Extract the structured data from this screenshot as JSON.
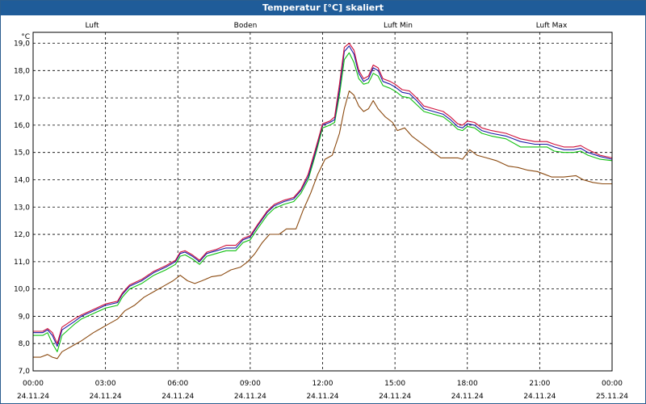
{
  "window": {
    "title": "Temperatur [°C] skaliert"
  },
  "chart_data": {
    "type": "line",
    "title": "Temperatur [°C] skaliert",
    "ylabel": "°C",
    "xlabel": "",
    "ylim": [
      7.0,
      19.4
    ],
    "xlim": [
      0,
      24
    ],
    "yticks": [
      "7,0",
      "8,0",
      "9,0",
      "10,0",
      "11,0",
      "12,0",
      "13,0",
      "14,0",
      "15,0",
      "16,0",
      "17,0",
      "18,0",
      "19,0"
    ],
    "ytick_values": [
      7,
      8,
      9,
      10,
      11,
      12,
      13,
      14,
      15,
      16,
      17,
      18,
      19
    ],
    "xticks": [
      {
        "t": 0,
        "time": "00:00",
        "date": "24.11.24"
      },
      {
        "t": 3,
        "time": "03:00",
        "date": "24.11.24"
      },
      {
        "t": 6,
        "time": "06:00",
        "date": "24.11.24"
      },
      {
        "t": 9,
        "time": "09:00",
        "date": "24.11.24"
      },
      {
        "t": 12,
        "time": "12:00",
        "date": "24.11.24"
      },
      {
        "t": 15,
        "time": "15:00",
        "date": "24.11.24"
      },
      {
        "t": 18,
        "time": "18:00",
        "date": "24.11.24"
      },
      {
        "t": 21,
        "time": "21:00",
        "date": "24.11.24"
      },
      {
        "t": 24,
        "time": "00:00",
        "date": "25.11.24"
      }
    ],
    "grid": true,
    "legend_placement": "top",
    "series": [
      {
        "name": "Luft",
        "color": "#1a1aa6",
        "points": [
          [
            0,
            8.4
          ],
          [
            0.4,
            8.4
          ],
          [
            0.6,
            8.5
          ],
          [
            0.8,
            8.3
          ],
          [
            1.0,
            7.9
          ],
          [
            1.2,
            8.5
          ],
          [
            1.7,
            8.8
          ],
          [
            2.0,
            9.0
          ],
          [
            2.5,
            9.2
          ],
          [
            3.0,
            9.4
          ],
          [
            3.5,
            9.5
          ],
          [
            3.7,
            9.8
          ],
          [
            4.0,
            10.1
          ],
          [
            4.5,
            10.3
          ],
          [
            5.0,
            10.6
          ],
          [
            5.5,
            10.8
          ],
          [
            5.9,
            11.0
          ],
          [
            6.1,
            11.3
          ],
          [
            6.3,
            11.35
          ],
          [
            6.6,
            11.2
          ],
          [
            6.9,
            11.0
          ],
          [
            7.2,
            11.3
          ],
          [
            7.6,
            11.4
          ],
          [
            8.0,
            11.5
          ],
          [
            8.4,
            11.5
          ],
          [
            8.7,
            11.8
          ],
          [
            9.0,
            11.9
          ],
          [
            9.3,
            12.3
          ],
          [
            9.7,
            12.8
          ],
          [
            10.0,
            13.05
          ],
          [
            10.4,
            13.2
          ],
          [
            10.8,
            13.3
          ],
          [
            11.1,
            13.6
          ],
          [
            11.4,
            14.1
          ],
          [
            11.7,
            15.0
          ],
          [
            12.0,
            16.0
          ],
          [
            12.3,
            16.1
          ],
          [
            12.5,
            16.2
          ],
          [
            12.7,
            17.3
          ],
          [
            12.9,
            18.7
          ],
          [
            13.1,
            18.9
          ],
          [
            13.3,
            18.6
          ],
          [
            13.5,
            17.9
          ],
          [
            13.7,
            17.6
          ],
          [
            13.9,
            17.7
          ],
          [
            14.1,
            18.1
          ],
          [
            14.3,
            18.0
          ],
          [
            14.5,
            17.6
          ],
          [
            14.8,
            17.5
          ],
          [
            15.0,
            17.4
          ],
          [
            15.3,
            17.2
          ],
          [
            15.6,
            17.15
          ],
          [
            15.9,
            16.9
          ],
          [
            16.2,
            16.6
          ],
          [
            16.6,
            16.5
          ],
          [
            17.0,
            16.4
          ],
          [
            17.3,
            16.2
          ],
          [
            17.6,
            15.95
          ],
          [
            17.8,
            15.9
          ],
          [
            18.0,
            16.05
          ],
          [
            18.3,
            16.0
          ],
          [
            18.6,
            15.8
          ],
          [
            19.0,
            15.7
          ],
          [
            19.6,
            15.6
          ],
          [
            20.2,
            15.4
          ],
          [
            20.8,
            15.3
          ],
          [
            21.3,
            15.3
          ],
          [
            21.6,
            15.2
          ],
          [
            22.0,
            15.1
          ],
          [
            22.4,
            15.1
          ],
          [
            22.7,
            15.15
          ],
          [
            23.0,
            15.0
          ],
          [
            23.5,
            14.85
          ],
          [
            24.0,
            14.75
          ]
        ]
      },
      {
        "name": "Boden",
        "color": "#8b4a10",
        "points": [
          [
            0,
            7.5
          ],
          [
            0.3,
            7.5
          ],
          [
            0.6,
            7.6
          ],
          [
            0.8,
            7.5
          ],
          [
            1.0,
            7.45
          ],
          [
            1.2,
            7.7
          ],
          [
            1.6,
            7.9
          ],
          [
            2.0,
            8.1
          ],
          [
            2.5,
            8.4
          ],
          [
            3.0,
            8.65
          ],
          [
            3.5,
            8.9
          ],
          [
            3.8,
            9.2
          ],
          [
            4.2,
            9.4
          ],
          [
            4.6,
            9.7
          ],
          [
            5.0,
            9.9
          ],
          [
            5.4,
            10.1
          ],
          [
            5.8,
            10.3
          ],
          [
            6.1,
            10.5
          ],
          [
            6.4,
            10.3
          ],
          [
            6.7,
            10.2
          ],
          [
            7.0,
            10.3
          ],
          [
            7.4,
            10.45
          ],
          [
            7.8,
            10.5
          ],
          [
            8.2,
            10.7
          ],
          [
            8.6,
            10.8
          ],
          [
            8.9,
            11.0
          ],
          [
            9.2,
            11.3
          ],
          [
            9.5,
            11.7
          ],
          [
            9.8,
            12.0
          ],
          [
            10.2,
            12.0
          ],
          [
            10.5,
            12.2
          ],
          [
            10.9,
            12.2
          ],
          [
            11.2,
            12.9
          ],
          [
            11.5,
            13.5
          ],
          [
            11.8,
            14.2
          ],
          [
            12.1,
            14.75
          ],
          [
            12.4,
            14.9
          ],
          [
            12.7,
            15.7
          ],
          [
            12.9,
            16.6
          ],
          [
            13.1,
            17.25
          ],
          [
            13.3,
            17.1
          ],
          [
            13.5,
            16.7
          ],
          [
            13.7,
            16.5
          ],
          [
            13.9,
            16.6
          ],
          [
            14.1,
            16.9
          ],
          [
            14.3,
            16.6
          ],
          [
            14.6,
            16.3
          ],
          [
            14.9,
            16.1
          ],
          [
            15.1,
            15.8
          ],
          [
            15.4,
            15.9
          ],
          [
            15.7,
            15.6
          ],
          [
            16.0,
            15.4
          ],
          [
            16.3,
            15.2
          ],
          [
            16.6,
            15.0
          ],
          [
            16.9,
            14.8
          ],
          [
            17.2,
            14.8
          ],
          [
            17.6,
            14.8
          ],
          [
            17.8,
            14.75
          ],
          [
            18.1,
            15.1
          ],
          [
            18.4,
            14.9
          ],
          [
            18.8,
            14.8
          ],
          [
            19.2,
            14.7
          ],
          [
            19.7,
            14.5
          ],
          [
            20.1,
            14.45
          ],
          [
            20.5,
            14.35
          ],
          [
            20.9,
            14.3
          ],
          [
            21.2,
            14.2
          ],
          [
            21.5,
            14.1
          ],
          [
            22.0,
            14.1
          ],
          [
            22.5,
            14.15
          ],
          [
            22.8,
            14.0
          ],
          [
            23.2,
            13.9
          ],
          [
            23.6,
            13.85
          ],
          [
            24.0,
            13.85
          ]
        ]
      },
      {
        "name": "Luft Min",
        "color": "#10c010",
        "points": [
          [
            0,
            8.3
          ],
          [
            0.4,
            8.3
          ],
          [
            0.6,
            8.4
          ],
          [
            0.8,
            8.0
          ],
          [
            1.0,
            7.7
          ],
          [
            1.2,
            8.3
          ],
          [
            1.7,
            8.7
          ],
          [
            2.0,
            8.9
          ],
          [
            2.5,
            9.1
          ],
          [
            3.0,
            9.3
          ],
          [
            3.5,
            9.4
          ],
          [
            3.7,
            9.7
          ],
          [
            4.0,
            10.0
          ],
          [
            4.5,
            10.2
          ],
          [
            5.0,
            10.5
          ],
          [
            5.5,
            10.7
          ],
          [
            5.9,
            10.9
          ],
          [
            6.1,
            11.2
          ],
          [
            6.3,
            11.25
          ],
          [
            6.6,
            11.1
          ],
          [
            6.9,
            10.9
          ],
          [
            7.2,
            11.2
          ],
          [
            7.6,
            11.3
          ],
          [
            8.0,
            11.4
          ],
          [
            8.4,
            11.4
          ],
          [
            8.7,
            11.7
          ],
          [
            9.0,
            11.8
          ],
          [
            9.3,
            12.2
          ],
          [
            9.7,
            12.7
          ],
          [
            10.0,
            12.95
          ],
          [
            10.4,
            13.1
          ],
          [
            10.8,
            13.2
          ],
          [
            11.1,
            13.5
          ],
          [
            11.4,
            14.0
          ],
          [
            11.7,
            14.9
          ],
          [
            12.0,
            15.9
          ],
          [
            12.3,
            16.0
          ],
          [
            12.5,
            16.1
          ],
          [
            12.7,
            17.1
          ],
          [
            12.9,
            18.4
          ],
          [
            13.1,
            18.65
          ],
          [
            13.3,
            18.3
          ],
          [
            13.5,
            17.7
          ],
          [
            13.7,
            17.5
          ],
          [
            13.9,
            17.55
          ],
          [
            14.1,
            17.9
          ],
          [
            14.3,
            17.8
          ],
          [
            14.5,
            17.45
          ],
          [
            14.8,
            17.35
          ],
          [
            15.0,
            17.25
          ],
          [
            15.3,
            17.05
          ],
          [
            15.6,
            17.0
          ],
          [
            15.9,
            16.75
          ],
          [
            16.2,
            16.5
          ],
          [
            16.6,
            16.4
          ],
          [
            17.0,
            16.3
          ],
          [
            17.3,
            16.1
          ],
          [
            17.6,
            15.85
          ],
          [
            17.8,
            15.8
          ],
          [
            18.0,
            15.95
          ],
          [
            18.3,
            15.9
          ],
          [
            18.6,
            15.7
          ],
          [
            19.0,
            15.6
          ],
          [
            19.6,
            15.5
          ],
          [
            20.2,
            15.2
          ],
          [
            20.8,
            15.2
          ],
          [
            21.3,
            15.2
          ],
          [
            21.6,
            15.05
          ],
          [
            22.0,
            15.0
          ],
          [
            22.4,
            15.0
          ],
          [
            22.7,
            15.05
          ],
          [
            23.0,
            14.9
          ],
          [
            23.5,
            14.75
          ],
          [
            24.0,
            14.7
          ]
        ]
      },
      {
        "name": "Luft Max",
        "color": "#d0103a",
        "points": [
          [
            0,
            8.45
          ],
          [
            0.4,
            8.45
          ],
          [
            0.6,
            8.55
          ],
          [
            0.8,
            8.4
          ],
          [
            1.0,
            8.0
          ],
          [
            1.2,
            8.6
          ],
          [
            1.7,
            8.9
          ],
          [
            2.0,
            9.05
          ],
          [
            2.5,
            9.25
          ],
          [
            3.0,
            9.45
          ],
          [
            3.5,
            9.55
          ],
          [
            3.7,
            9.85
          ],
          [
            4.0,
            10.15
          ],
          [
            4.5,
            10.35
          ],
          [
            5.0,
            10.65
          ],
          [
            5.5,
            10.85
          ],
          [
            5.9,
            11.05
          ],
          [
            6.1,
            11.35
          ],
          [
            6.3,
            11.4
          ],
          [
            6.6,
            11.25
          ],
          [
            6.9,
            11.05
          ],
          [
            7.2,
            11.35
          ],
          [
            7.6,
            11.45
          ],
          [
            8.0,
            11.6
          ],
          [
            8.4,
            11.6
          ],
          [
            8.7,
            11.85
          ],
          [
            9.0,
            11.95
          ],
          [
            9.3,
            12.35
          ],
          [
            9.7,
            12.85
          ],
          [
            10.0,
            13.1
          ],
          [
            10.4,
            13.25
          ],
          [
            10.8,
            13.35
          ],
          [
            11.1,
            13.65
          ],
          [
            11.4,
            14.2
          ],
          [
            11.7,
            15.1
          ],
          [
            12.0,
            16.05
          ],
          [
            12.3,
            16.15
          ],
          [
            12.5,
            16.3
          ],
          [
            12.7,
            17.5
          ],
          [
            12.9,
            18.85
          ],
          [
            13.1,
            19.0
          ],
          [
            13.3,
            18.75
          ],
          [
            13.5,
            18.0
          ],
          [
            13.7,
            17.7
          ],
          [
            13.9,
            17.8
          ],
          [
            14.1,
            18.2
          ],
          [
            14.3,
            18.1
          ],
          [
            14.5,
            17.7
          ],
          [
            14.8,
            17.6
          ],
          [
            15.0,
            17.5
          ],
          [
            15.3,
            17.3
          ],
          [
            15.6,
            17.25
          ],
          [
            15.9,
            17.0
          ],
          [
            16.2,
            16.7
          ],
          [
            16.6,
            16.6
          ],
          [
            17.0,
            16.5
          ],
          [
            17.3,
            16.3
          ],
          [
            17.6,
            16.05
          ],
          [
            17.8,
            16.0
          ],
          [
            18.0,
            16.15
          ],
          [
            18.3,
            16.1
          ],
          [
            18.6,
            15.9
          ],
          [
            19.0,
            15.8
          ],
          [
            19.6,
            15.7
          ],
          [
            20.2,
            15.5
          ],
          [
            20.8,
            15.4
          ],
          [
            21.3,
            15.4
          ],
          [
            21.6,
            15.3
          ],
          [
            22.0,
            15.2
          ],
          [
            22.4,
            15.2
          ],
          [
            22.7,
            15.25
          ],
          [
            23.0,
            15.1
          ],
          [
            23.5,
            14.9
          ],
          [
            24.0,
            14.8
          ]
        ]
      }
    ]
  }
}
